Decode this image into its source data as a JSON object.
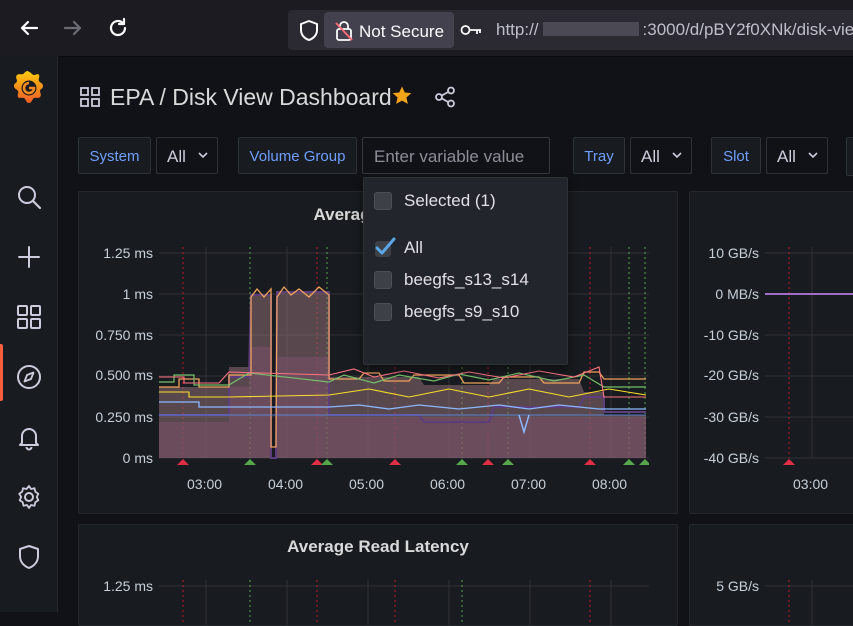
{
  "browser": {
    "security_label": "Not Secure",
    "url_prefix": "http://",
    "url_suffix": ":3000/d/pBY2f0XNk/disk-vie"
  },
  "dashboard": {
    "folder": "EPA",
    "separator": "/",
    "title": "Disk View Dashboard"
  },
  "variables": [
    {
      "label": "System",
      "value": "All"
    },
    {
      "label": "Volume Group",
      "placeholder": "Enter variable value"
    },
    {
      "label": "Tray",
      "value": "All"
    },
    {
      "label": "Slot",
      "value": "All"
    }
  ],
  "dropdown": {
    "header": "Selected (1)",
    "options": [
      {
        "label": "All",
        "checked": true
      },
      {
        "label": "beegfs_s13_s14",
        "checked": false
      },
      {
        "label": "beegfs_s9_s10",
        "checked": false
      }
    ]
  },
  "panels": {
    "avg_latency": {
      "title_visible": "Averag",
      "y_ticks": [
        "1.25 ms",
        "1 ms",
        "0.750 ms",
        "0.500 ms",
        "0.250 ms",
        "0 ms"
      ],
      "x_ticks": [
        "03:00",
        "04:00",
        "05:00",
        "06:00",
        "07:00",
        "08:00"
      ]
    },
    "throughput": {
      "y_ticks": [
        "10 GB/s",
        "0 MB/s",
        "-10 GB/s",
        "-20 GB/s",
        "-30 GB/s",
        "-40 GB/s"
      ],
      "x_ticks": [
        "03:00"
      ]
    },
    "avg_read_latency": {
      "title": "Average Read Latency",
      "y_ticks": [
        "1.25 ms"
      ]
    },
    "bottom_right": {
      "y_ticks": [
        "5 GB/s"
      ]
    }
  },
  "colors": {
    "accent_orange": "#f55f3e",
    "link_blue": "#6e9fff",
    "star": "#f5a31a",
    "checkbox": "#3d71d9"
  }
}
